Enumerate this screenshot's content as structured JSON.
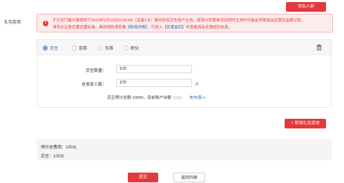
{
  "header": {
    "add_people_label": "添加人群"
  },
  "gift": {
    "label": "礼包奖项:",
    "notice": {
      "line1": "平行式门槛计算规则于2019年2月15日01:00:00（凌晨1点）面向所有京东用户生效。促销与优惠券活动同时生效时可能会导致商品优惠后金额过低，",
      "line2_before": "请务必注意优惠设置标准。具体规则请查看",
      "link1": "【新规详情】",
      "line2_mid": "，可进入",
      "link2": "【优惠监控】",
      "line2_after": "中查看商品优惠超扣信息。"
    },
    "types": [
      {
        "label": "京豆",
        "selected": true
      },
      {
        "label": "京券",
        "selected": false
      },
      {
        "label": "东券",
        "selected": false
      },
      {
        "label": "积分",
        "selected": false
      }
    ],
    "fields": {
      "bean_count_label": "京豆数量：",
      "bean_count_value": "100",
      "people_label": "总发放人数：",
      "people_value": "100",
      "people_unit": "人"
    },
    "estimate": {
      "text": "京豆预计总额 10000，目前账户余额",
      "link": "去充值>>"
    }
  },
  "actions": {
    "add_gift_label": "+ 新增礼包奖项",
    "submit_label": "提交",
    "back_label": "返回列表"
  },
  "summary": {
    "total": "预计总费用：100元",
    "bean": "京豆：100元"
  },
  "colors": {
    "accent": "#e4393c",
    "link": "#2b6cb0"
  }
}
